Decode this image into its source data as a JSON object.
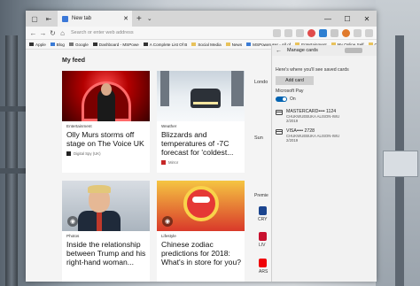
{
  "browser": {
    "tab_title": "New tab",
    "address_placeholder": "Search or enter web address",
    "favorites": [
      {
        "label": "Apple",
        "color": "dark"
      },
      {
        "label": "Blog",
        "color": "blue"
      },
      {
        "label": "Google",
        "color": "grey"
      },
      {
        "label": "Dashboard - MSPowe",
        "color": "dark"
      },
      {
        "label": "A Complete List Of B",
        "color": "dark"
      },
      {
        "label": "Social Media",
        "color": "folder"
      },
      {
        "label": "News",
        "color": "folder"
      },
      {
        "label": "MSPoweruser - All of",
        "color": "blue"
      },
      {
        "label": "Entertainment",
        "color": "folder"
      },
      {
        "label": "My Online Self",
        "color": "folder"
      },
      {
        "label": "Office Suites",
        "color": "folder"
      }
    ]
  },
  "feed": {
    "header": "My feed",
    "cards": [
      {
        "category": "Entertainment",
        "title": "Olly Murs storms off stage on The Voice UK",
        "source": "Digital Spy (UK)"
      },
      {
        "category": "Weather",
        "title": "Blizzards and temperatures of -7C forecast for 'coldest...",
        "source": "Mirror"
      },
      {
        "category": "Photos",
        "title": "Inside the relationship between Trump and his right-hand woman...",
        "source": ""
      },
      {
        "category": "Lifestyle",
        "title": "Chinese zodiac predictions for 2018: What's in store for you?",
        "source": ""
      }
    ],
    "weather_city": "Londo",
    "weather_day": "Sun",
    "premier_label": "Premie",
    "team_labels": [
      "CRY",
      "LIV",
      "ARS"
    ]
  },
  "panel": {
    "title": "Manage cards",
    "description": "Here's where you'll see saved cards",
    "add_button": "Add card",
    "pay_label": "Microsoft Pay",
    "toggle_state": "On",
    "cards": [
      {
        "number": "MASTERCARD•••• 1124",
        "holder": "CHUKWUEBUKA ALISON-IWU",
        "expiry": "2/2019"
      },
      {
        "number": "VISA•••• 2728",
        "holder": "CHUKWUEBUKA ALISON-IWU",
        "expiry": "2/2019"
      }
    ]
  }
}
